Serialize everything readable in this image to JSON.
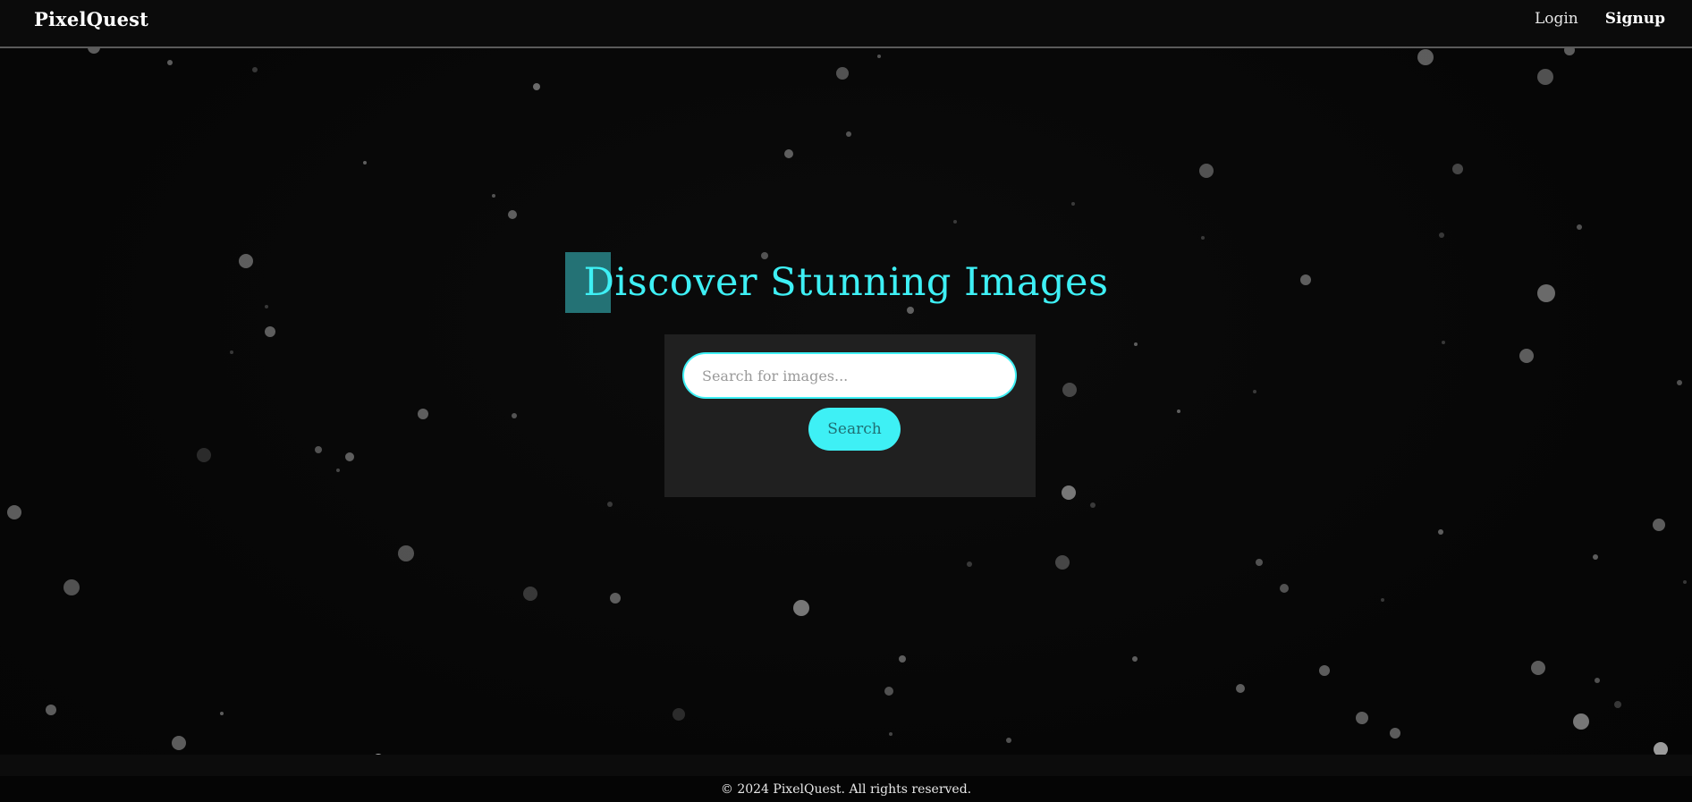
{
  "nav": {
    "brand": "PixelQuest",
    "login_label": "Login",
    "signup_label": "Signup"
  },
  "hero": {
    "title": "Discover Stunning Images"
  },
  "search": {
    "placeholder": "Search for images...",
    "value": "",
    "button_label": "Search"
  },
  "footer": {
    "text": "© 2024 PixelQuest. All rights reserved."
  },
  "colors": {
    "accent": "#3ef0f5",
    "background": "#070707",
    "panel": "#202020",
    "nav_border": "#5a5a5a"
  }
}
